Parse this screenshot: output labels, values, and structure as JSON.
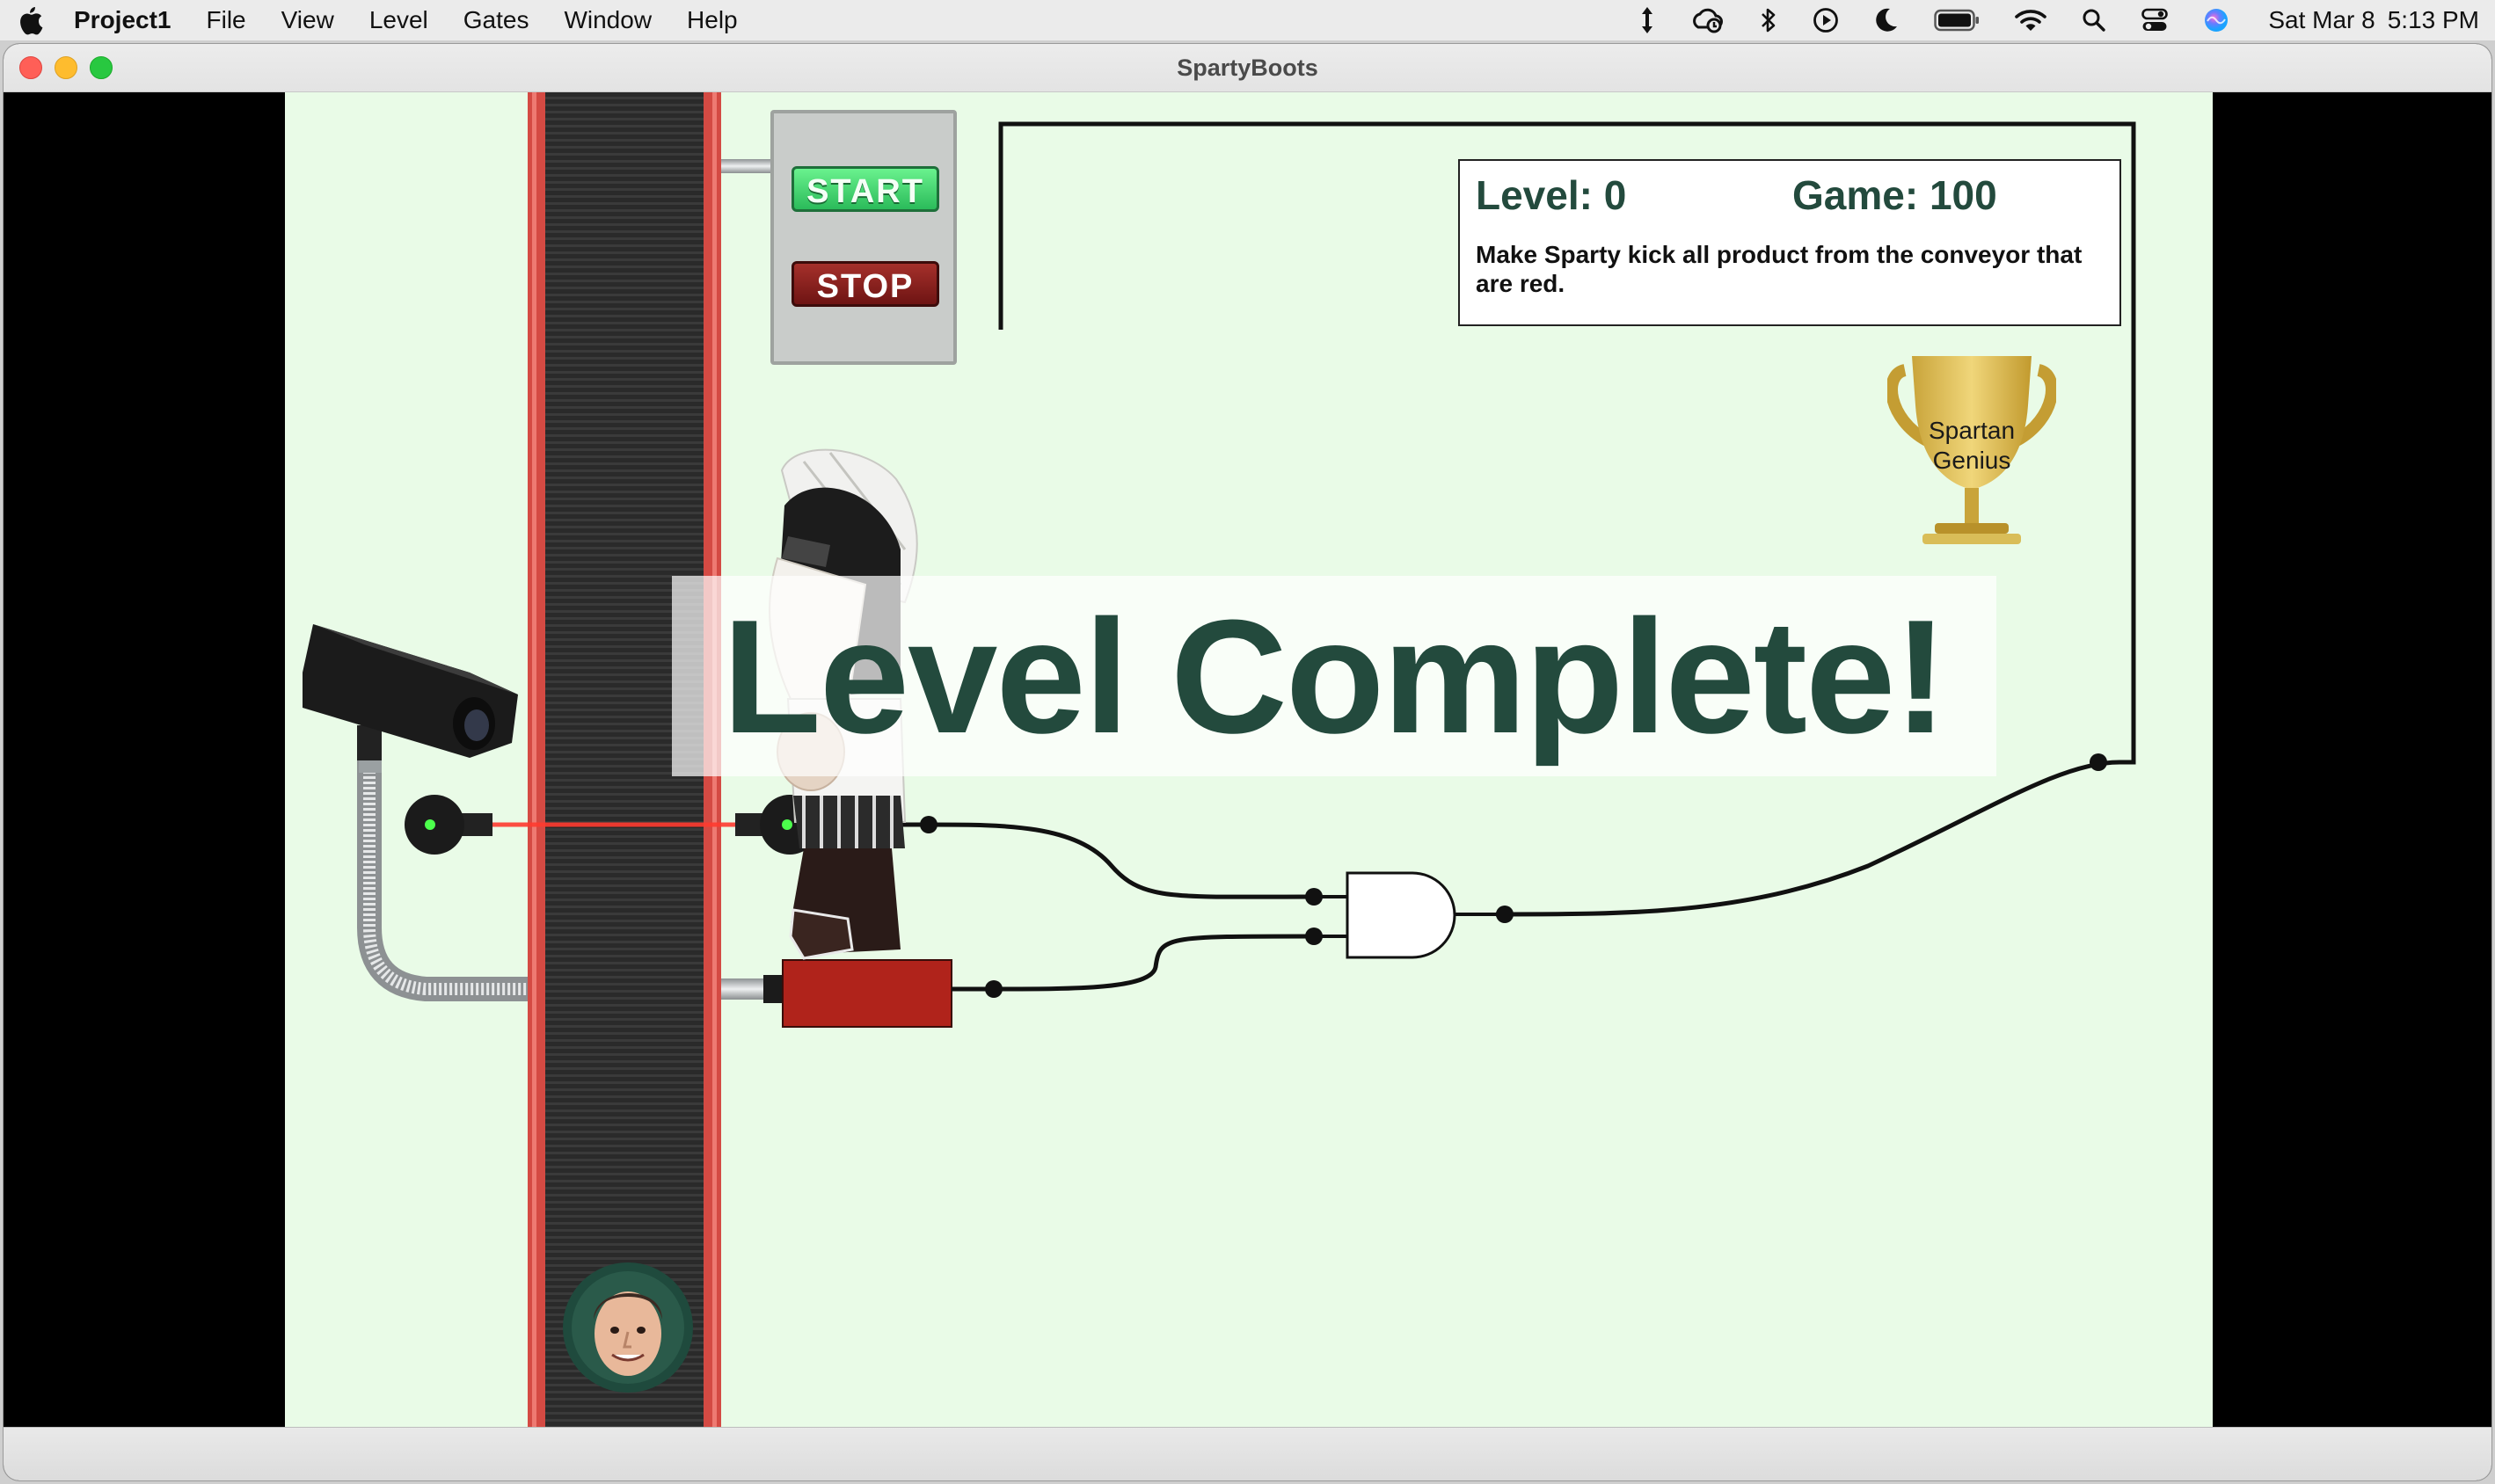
{
  "menubar": {
    "app_name": "Project1",
    "menus": [
      "File",
      "View",
      "Level",
      "Gates",
      "Window",
      "Help"
    ],
    "date": "Sat Mar 8",
    "time": "5:13 PM",
    "status_icons": [
      "keyboard-brightness-icon",
      "creative-cloud-icon",
      "bluetooth-icon",
      "play-circle-icon",
      "moon-icon",
      "battery-icon",
      "wifi-icon",
      "search-icon",
      "control-center-icon",
      "siri-icon"
    ]
  },
  "window": {
    "title": "SpartyBoots"
  },
  "game": {
    "level_label": "Level: 0",
    "game_label": "Game: 100",
    "instructions": "Make Sparty kick all product from the conveyor that are red.",
    "start_label": "START",
    "stop_label": "STOP",
    "trophy_line1": "Spartan",
    "trophy_line2": "Genius",
    "overlay_message": "Level Complete!",
    "product_color": "#b0231b",
    "background_color": "#e9fbe7",
    "text_color": "#234a3d"
  }
}
